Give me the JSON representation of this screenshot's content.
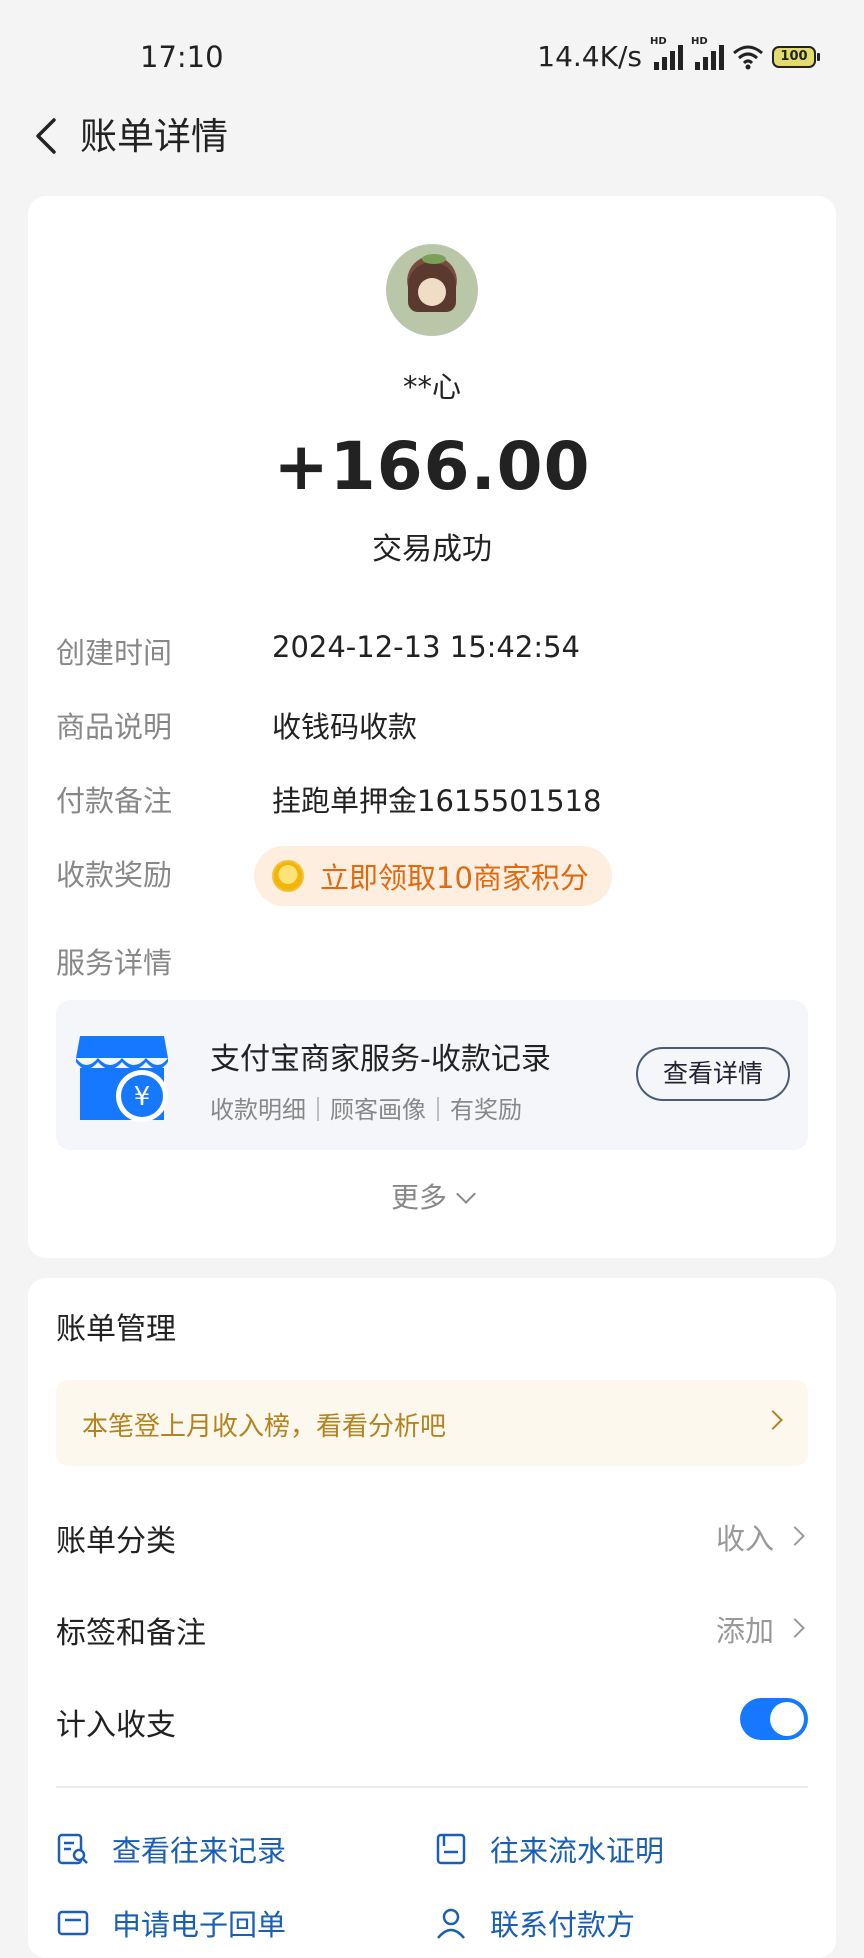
{
  "status_bar": {
    "time": "17:10",
    "speed": "14.4K/s",
    "network_badge": "HD",
    "battery": "100"
  },
  "header": {
    "title": "账单详情"
  },
  "payer": {
    "name": "**心"
  },
  "transaction": {
    "amount": "+166.00",
    "status": "交易成功"
  },
  "details": [
    {
      "label": "创建时间",
      "value": "2024-12-13 15:42:54"
    },
    {
      "label": "商品说明",
      "value": "收钱码收款"
    },
    {
      "label": "付款备注",
      "value": "挂跑单押金1615501518"
    }
  ],
  "reward": {
    "label": "收款奖励",
    "button": "立即领取10商家积分"
  },
  "service": {
    "section_label": "服务详情",
    "title": "支付宝商家服务-收款记录",
    "subtitle": "收款明细｜顾客画像｜有奖励",
    "button": "查看详情"
  },
  "more": {
    "label": "更多"
  },
  "bill_management": {
    "title": "账单管理",
    "tip": "本笔登上月收入榜，看看分析吧",
    "category": {
      "label": "账单分类",
      "value": "收入"
    },
    "tags": {
      "label": "标签和备注",
      "value": "添加"
    },
    "include": {
      "label": "计入收支",
      "enabled": true
    }
  },
  "actions": [
    {
      "label": "查看往来记录",
      "icon": "search-records-icon"
    },
    {
      "label": "往来流水证明",
      "icon": "statement-icon"
    },
    {
      "label": "申请电子回单",
      "icon": "receipt-icon"
    },
    {
      "label": "联系付款方",
      "icon": "contact-icon"
    }
  ],
  "colors": {
    "accent": "#1677ff",
    "reward": "#e06a10",
    "tip": "#b38320",
    "link": "#1a5fb4"
  }
}
